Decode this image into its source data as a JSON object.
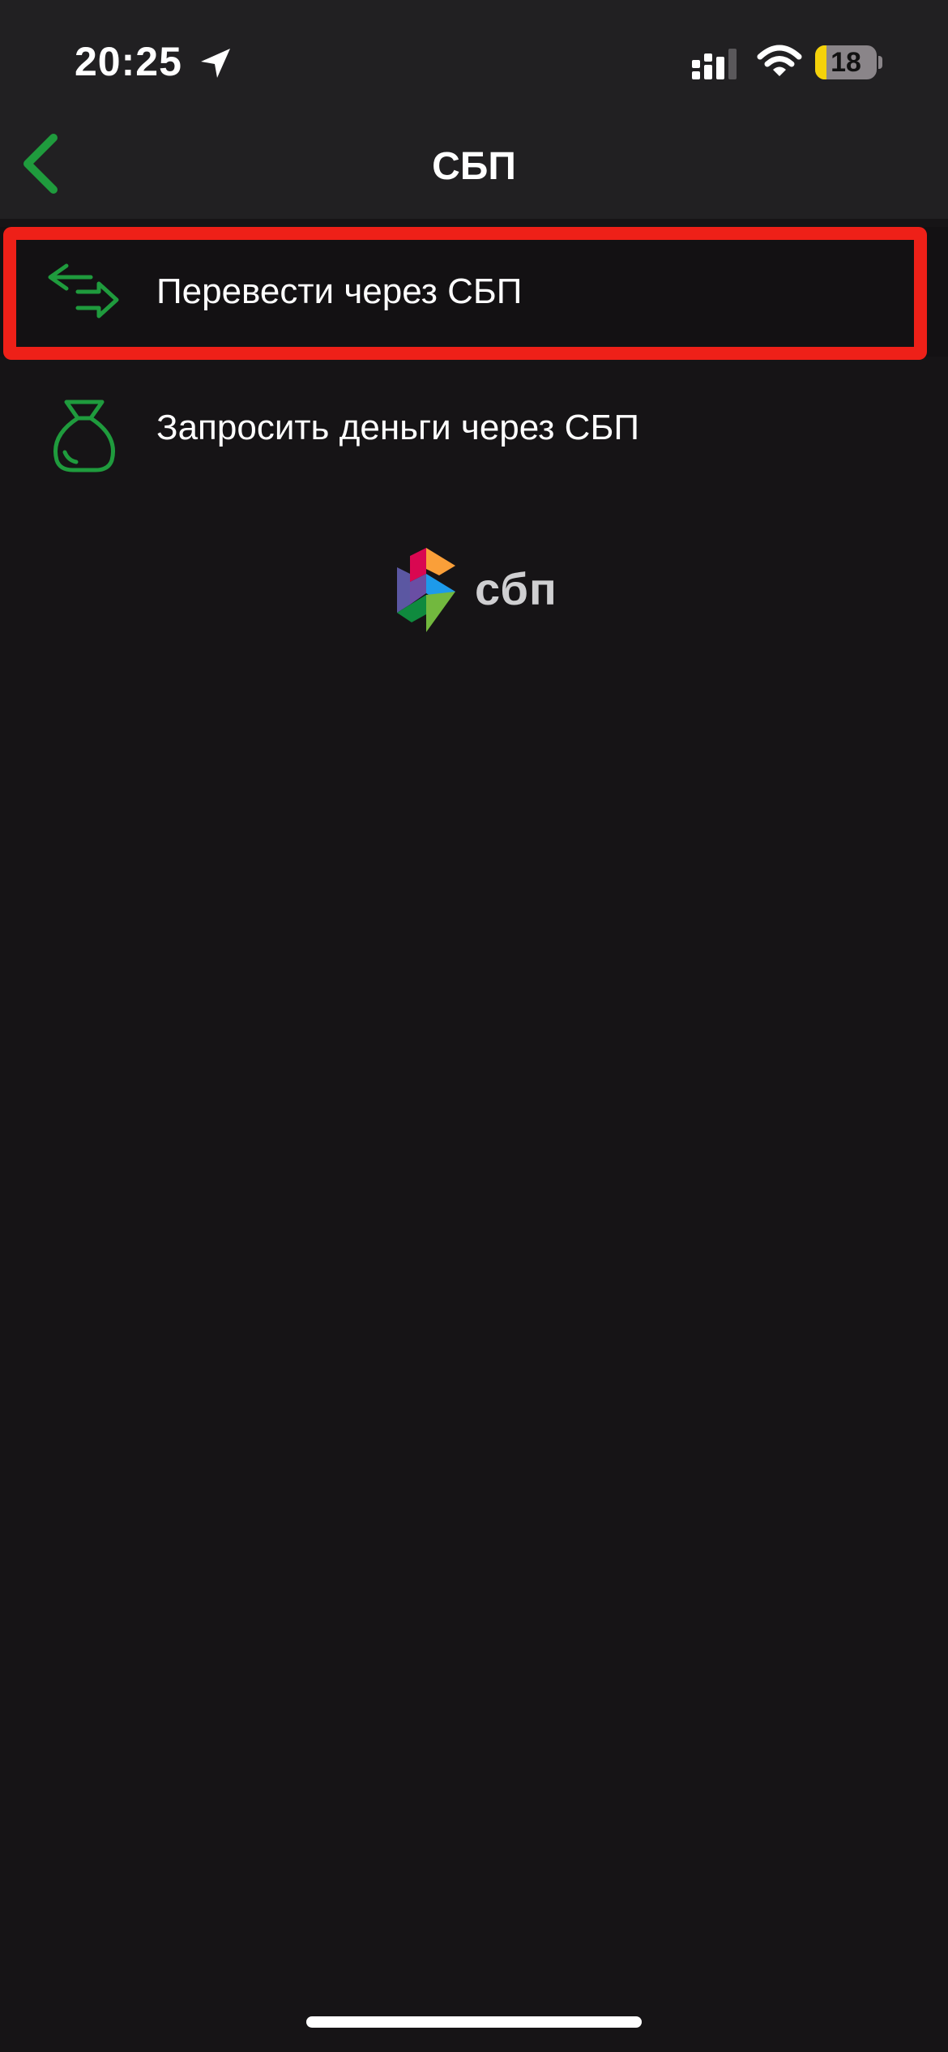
{
  "status_bar": {
    "time": "20:25",
    "battery_level": "18",
    "battery_fraction": 0.18
  },
  "navigation": {
    "title": "СБП"
  },
  "menu": {
    "items": [
      {
        "label": "Перевести через СБП",
        "icon": "arrow-transfer-icon"
      },
      {
        "label": "Запросить деньги через СБП",
        "icon": "money-bag-icon"
      }
    ]
  },
  "logo": {
    "text": "сбп"
  },
  "colors": {
    "accent": "#1f9b3d",
    "highlight": "#ee2018",
    "background": "#161416",
    "header": "#212022"
  }
}
